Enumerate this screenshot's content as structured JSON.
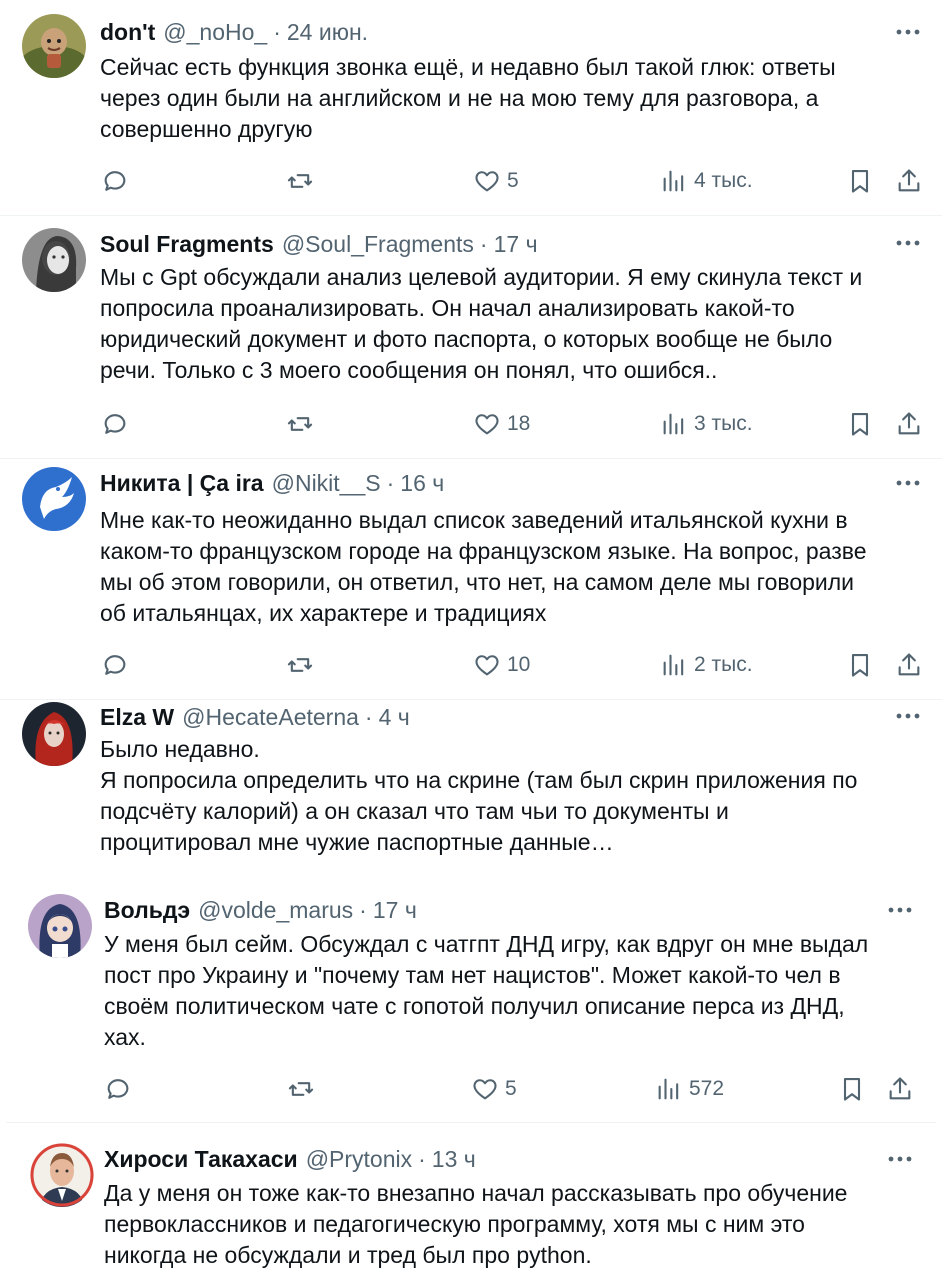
{
  "tweets": [
    {
      "name": "don't",
      "handle": "@_noHo_",
      "sep": "·",
      "time": "24 июн.",
      "text": "Сейчас есть функция звонка ещё, и недавно был такой глюк: ответы\nчерез один были на английском и не на мою тему для разговора, а\nсовершенно другую",
      "likes": "5",
      "views": "4 тыс."
    },
    {
      "name": "Soul Fragments",
      "handle": "@Soul_Fragments",
      "sep": "·",
      "time": "17 ч",
      "text": "Мы с Gpt обсуждали анализ целевой аудитории. Я ему скинула текст и\nпопросила проанализировать. Он начал анализировать какой-то\nюридический документ и фото паспорта, о которых вообще не было\nречи. Только с 3 моего сообщения он понял, что ошибся..",
      "likes": "18",
      "views": "3 тыс."
    },
    {
      "name": "Никита | Ça ira",
      "handle": "@Nikit__S",
      "sep": "·",
      "time": "16 ч",
      "text": "Мне как-то неожиданно выдал список заведений итальянской кухни в\nкаком-то французском городе на французском языке. На вопрос, разве\nмы об этом говорили, он ответил, что нет, на самом деле мы говорили\nоб итальянцах, их характере и традициях",
      "likes": "10",
      "views": "2 тыс."
    },
    {
      "name": "Elza W",
      "handle": "@HecateAeterna",
      "sep": "·",
      "time": "4 ч",
      "text": "Было недавно.\nЯ попросила определить что на скрине (там был скрин приложения по\nподсчёту калорий) а он сказал что там чьи то документы и\nпроцитировал мне чужие паспортные данные…"
    },
    {
      "name": "Вольдэ",
      "handle": "@volde_marus",
      "sep": "·",
      "time": "17 ч",
      "text": "У меня был сейм. Обсуждал с чатгпт ДНД игру, как вдруг он мне выдал\nпост про Украину и \"почему там нет нацистов\". Может какой-то чел в\nсвоём политическом чате с гопотой получил описание перса из ДНД,\nхах.",
      "likes": "5",
      "views": "572"
    },
    {
      "name": "Хироси Такахаси",
      "handle": "@Prytonix",
      "sep": "·",
      "time": "13 ч",
      "text": "Да у меня он тоже как-то внезапно начал рассказывать про обучение\nпервоклассников и педагогическую программу,  хотя мы с ним это\nникогда не обсуждали и тред был про python."
    }
  ],
  "icons": {
    "reply": "reply-icon",
    "retweet": "retweet-icon",
    "like": "heart-icon",
    "views": "views-icon",
    "bookmark": "bookmark-icon",
    "share": "share-icon",
    "more": "more-icon"
  },
  "colors": {
    "text": "#0f1419",
    "secondary": "#536471",
    "divider": "#eff3f4"
  }
}
